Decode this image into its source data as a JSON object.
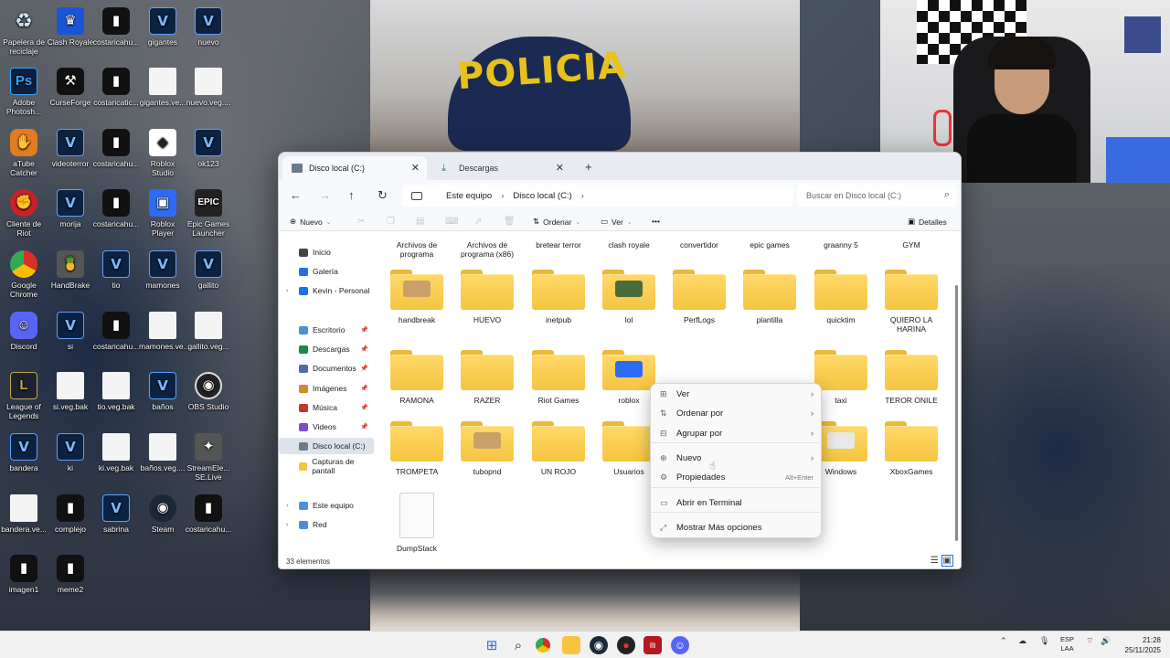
{
  "desktop": {
    "icons": [
      {
        "label": "Papelera de reciclaje",
        "icon": "recycle-bin-icon"
      },
      {
        "label": "Clash Royale",
        "icon": "game-icon"
      },
      {
        "label": "costaricahu...",
        "icon": "video-file-icon"
      },
      {
        "label": "gigantes",
        "icon": "vegas-project-icon"
      },
      {
        "label": "nuevo",
        "icon": "vegas-project-icon"
      },
      {
        "label": "Adobe Photosh...",
        "icon": "photoshop-icon"
      },
      {
        "label": "CurseForge",
        "icon": "curseforge-icon"
      },
      {
        "label": "costaricatic...",
        "icon": "video-file-icon"
      },
      {
        "label": "gigantes.ve...",
        "icon": "file-icon"
      },
      {
        "label": "nuevo.veg....",
        "icon": "file-icon"
      },
      {
        "label": "aTube Catcher",
        "icon": "atube-icon"
      },
      {
        "label": "videoterror",
        "icon": "vegas-project-icon"
      },
      {
        "label": "costaricahu...",
        "icon": "video-file-icon"
      },
      {
        "label": "Roblox Studio",
        "icon": "roblox-studio-icon"
      },
      {
        "label": "ok123",
        "icon": "vegas-project-icon"
      },
      {
        "label": "Cliente de Riot",
        "icon": "riot-icon"
      },
      {
        "label": "morija",
        "icon": "vegas-project-icon"
      },
      {
        "label": "costaricahu...",
        "icon": "video-file-icon"
      },
      {
        "label": "Roblox Player",
        "icon": "roblox-player-icon"
      },
      {
        "label": "Epic Games Launcher",
        "icon": "epic-games-icon"
      },
      {
        "label": "Google Chrome",
        "icon": "chrome-icon"
      },
      {
        "label": "HandBrake",
        "icon": "handbrake-icon"
      },
      {
        "label": "tio",
        "icon": "vegas-project-icon"
      },
      {
        "label": "mamones",
        "icon": "vegas-project-icon"
      },
      {
        "label": "gallito",
        "icon": "vegas-project-icon"
      },
      {
        "label": "Discord",
        "icon": "discord-icon"
      },
      {
        "label": "si",
        "icon": "vegas-project-icon"
      },
      {
        "label": "costaricahu...",
        "icon": "video-file-icon"
      },
      {
        "label": "mamones.ve...",
        "icon": "file-icon"
      },
      {
        "label": "gallito.veg...",
        "icon": "file-icon"
      },
      {
        "label": "League of Legends",
        "icon": "league-icon"
      },
      {
        "label": "si.veg.bak",
        "icon": "file-icon"
      },
      {
        "label": "tio.veg.bak",
        "icon": "file-icon"
      },
      {
        "label": "baños",
        "icon": "vegas-project-icon"
      },
      {
        "label": "OBS Studio",
        "icon": "obs-icon"
      },
      {
        "label": "bandera",
        "icon": "vegas-project-icon"
      },
      {
        "label": "ki",
        "icon": "vegas-project-icon"
      },
      {
        "label": "ki.veg.bak",
        "icon": "file-icon"
      },
      {
        "label": "baños.veg....",
        "icon": "file-icon"
      },
      {
        "label": "StreamEle... SE.Live",
        "icon": "streamelements-icon"
      },
      {
        "label": "bandera.ve...",
        "icon": "file-icon"
      },
      {
        "label": "complejo",
        "icon": "video-file-icon"
      },
      {
        "label": "sabrina",
        "icon": "vegas-project-icon"
      },
      {
        "label": "Steam",
        "icon": "steam-icon"
      },
      {
        "label": "costaricahu...",
        "icon": "video-file-icon"
      },
      {
        "label": "imagen1",
        "icon": "video-file-icon"
      },
      {
        "label": "meme2",
        "icon": "video-file-icon"
      }
    ]
  },
  "scene": {
    "cap_text": "POLICIA"
  },
  "explorer": {
    "tabs": [
      {
        "label": "Disco local (C:)",
        "icon": "drive-icon"
      },
      {
        "label": "Descargas",
        "icon": "download-icon"
      }
    ],
    "breadcrumb": [
      "Este equipo",
      "Disco local (C:)"
    ],
    "search_placeholder": "Buscar en Disco local (C:)",
    "toolbar": {
      "new_label": "Nuevo",
      "sort_label": "Ordenar",
      "view_label": "Ver",
      "details_label": "Detalles"
    },
    "sidebar": [
      {
        "label": "Inicio",
        "icon": "home-icon"
      },
      {
        "label": "Galería",
        "icon": "gallery-icon"
      },
      {
        "label": "Kevin - Personal",
        "icon": "cloud-icon"
      },
      {
        "label": "Escritorio",
        "icon": "desktop-icon"
      },
      {
        "label": "Descargas",
        "icon": "download-icon"
      },
      {
        "label": "Documentos",
        "icon": "documents-icon"
      },
      {
        "label": "Imágenes",
        "icon": "pictures-icon"
      },
      {
        "label": "Música",
        "icon": "music-icon"
      },
      {
        "label": "Videos",
        "icon": "videos-icon"
      },
      {
        "label": "Disco local (C:)",
        "icon": "drive-icon"
      },
      {
        "label": "Capturas de pantall",
        "icon": "folder-icon"
      },
      {
        "label": "Este equipo",
        "icon": "pc-icon"
      },
      {
        "label": "Red",
        "icon": "network-icon"
      }
    ],
    "items": [
      "Archivos de programa",
      "Archivos de programa (x86)",
      "bretear terror",
      "clash royale",
      "convertidor",
      "epic games",
      "graanny 5",
      "GYM",
      "handbreak",
      "HUEVO",
      "inetpub",
      "lol",
      "PerfLogs",
      "plantilla",
      "quicktim",
      "QUIERO LA HARINA",
      "RAMONA",
      "RAZER",
      "Riot Games",
      "roblox",
      "taxi",
      "TEROR ONILE",
      "TROMPETA",
      "tubopnd",
      "UN ROJO",
      "Usuarios",
      "Windows",
      "XboxGames",
      "DumpStack"
    ],
    "status": "33 elementos"
  },
  "context_menu": {
    "items": [
      {
        "label": "Ver",
        "icon": "view-icon",
        "submenu": true
      },
      {
        "label": "Ordenar por",
        "icon": "sort-icon",
        "submenu": true
      },
      {
        "label": "Agrupar por",
        "icon": "group-icon",
        "submenu": true
      },
      {
        "label": "Nuevo",
        "icon": "new-icon",
        "submenu": true
      },
      {
        "label": "Propiedades",
        "icon": "properties-icon",
        "shortcut": "Alt+Enter"
      },
      {
        "label": "Abrir en Terminal",
        "icon": "terminal-icon"
      },
      {
        "label": "Mostrar Más opciones",
        "icon": "more-options-icon"
      }
    ]
  },
  "taskbar": {
    "lang": [
      "ESP",
      "LAA"
    ],
    "time": "21:28",
    "date": "25/11/2025"
  }
}
